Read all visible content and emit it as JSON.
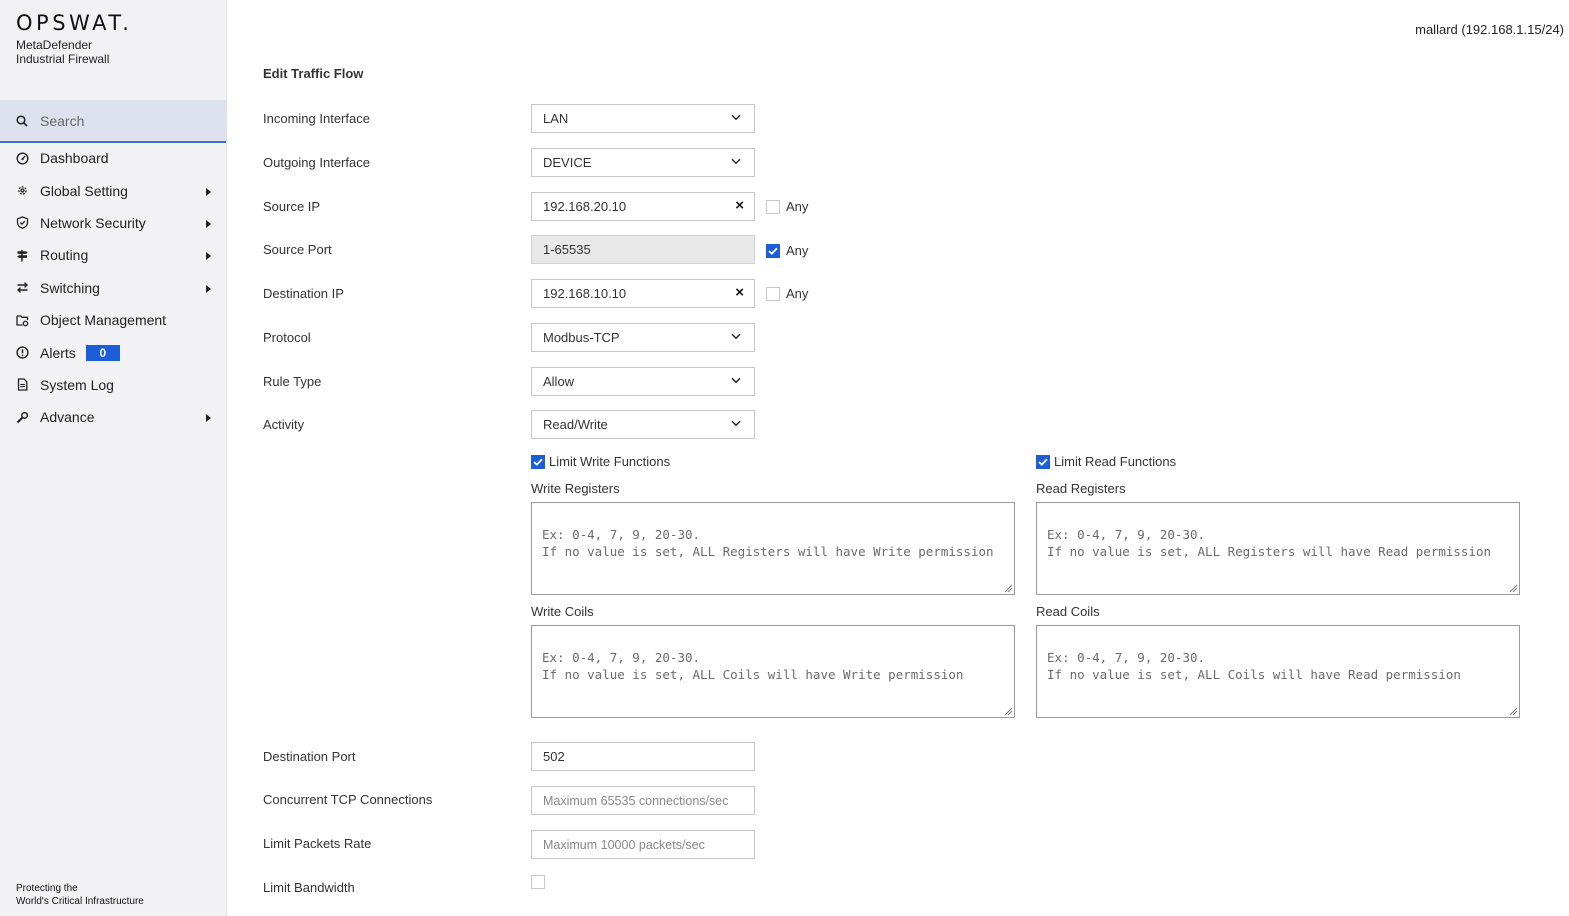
{
  "brand": {
    "name": "OPSWAT.",
    "product_line1": "MetaDefender",
    "product_line2": "Industrial Firewall",
    "tagline_line1": "Protecting the",
    "tagline_line2": "World's Critical Infrastructure"
  },
  "search": {
    "placeholder": "Search"
  },
  "sidebar": {
    "items": [
      {
        "label": "Dashboard",
        "icon": "dashboard-icon",
        "has_submenu": false
      },
      {
        "label": "Global Setting",
        "icon": "gear-icon",
        "has_submenu": true
      },
      {
        "label": "Network Security",
        "icon": "shield-icon",
        "has_submenu": true
      },
      {
        "label": "Routing",
        "icon": "signpost-icon",
        "has_submenu": true
      },
      {
        "label": "Switching",
        "icon": "swap-arrows-icon",
        "has_submenu": true
      },
      {
        "label": "Object Management",
        "icon": "folder-gear-icon",
        "has_submenu": false
      },
      {
        "label": "Alerts",
        "icon": "alert-circle-icon",
        "has_submenu": false,
        "badge": "0"
      },
      {
        "label": "System Log",
        "icon": "document-icon",
        "has_submenu": false
      },
      {
        "label": "Advance",
        "icon": "wrench-icon",
        "has_submenu": true
      }
    ]
  },
  "header": {
    "host": "mallard (192.168.1.15/24)"
  },
  "form": {
    "title": "Edit Traffic Flow",
    "incoming_interface": {
      "label": "Incoming Interface",
      "value": "LAN"
    },
    "outgoing_interface": {
      "label": "Outgoing Interface",
      "value": "DEVICE"
    },
    "source_ip": {
      "label": "Source IP",
      "value": "192.168.20.10",
      "clear": "×",
      "any_label": "Any",
      "any_checked": false
    },
    "source_port": {
      "label": "Source Port",
      "value": "1-65535",
      "any_label": "Any",
      "any_checked": true
    },
    "destination_ip": {
      "label": "Destination IP",
      "value": "192.168.10.10",
      "clear": "×",
      "any_label": "Any",
      "any_checked": false
    },
    "protocol": {
      "label": "Protocol",
      "value": "Modbus-TCP"
    },
    "rule_type": {
      "label": "Rule Type",
      "value": "Allow"
    },
    "activity": {
      "label": "Activity",
      "value": "Read/Write"
    },
    "limit_write": {
      "label": "Limit Write Functions",
      "checked": true,
      "registers_label": "Write Registers",
      "registers_placeholder": "Ex: 0-4, 7, 9, 20-30.\nIf no value is set, ALL Registers will have Write permission",
      "coils_label": "Write Coils",
      "coils_placeholder": "Ex: 0-4, 7, 9, 20-30.\nIf no value is set, ALL Coils will have Write permission"
    },
    "limit_read": {
      "label": "Limit Read Functions",
      "checked": true,
      "registers_label": "Read Registers",
      "registers_placeholder": "Ex: 0-4, 7, 9, 20-30.\nIf no value is set, ALL Registers will have Read permission",
      "coils_label": "Read Coils",
      "coils_placeholder": "Ex: 0-4, 7, 9, 20-30.\nIf no value is set, ALL Coils will have Read permission"
    },
    "destination_port": {
      "label": "Destination Port",
      "value": "502"
    },
    "concurrent_tcp": {
      "label": "Concurrent TCP Connections",
      "placeholder": "Maximum 65535 connections/sec"
    },
    "limit_packets": {
      "label": "Limit Packets Rate",
      "placeholder": "Maximum 10000 packets/sec"
    },
    "limit_bandwidth": {
      "label": "Limit Bandwidth",
      "checked": false
    }
  },
  "colors": {
    "accent": "#1b5ed8",
    "search_bg": "#dde2ee",
    "search_border": "#3f6bc2",
    "sidebar_bg": "#f2f2f4"
  }
}
